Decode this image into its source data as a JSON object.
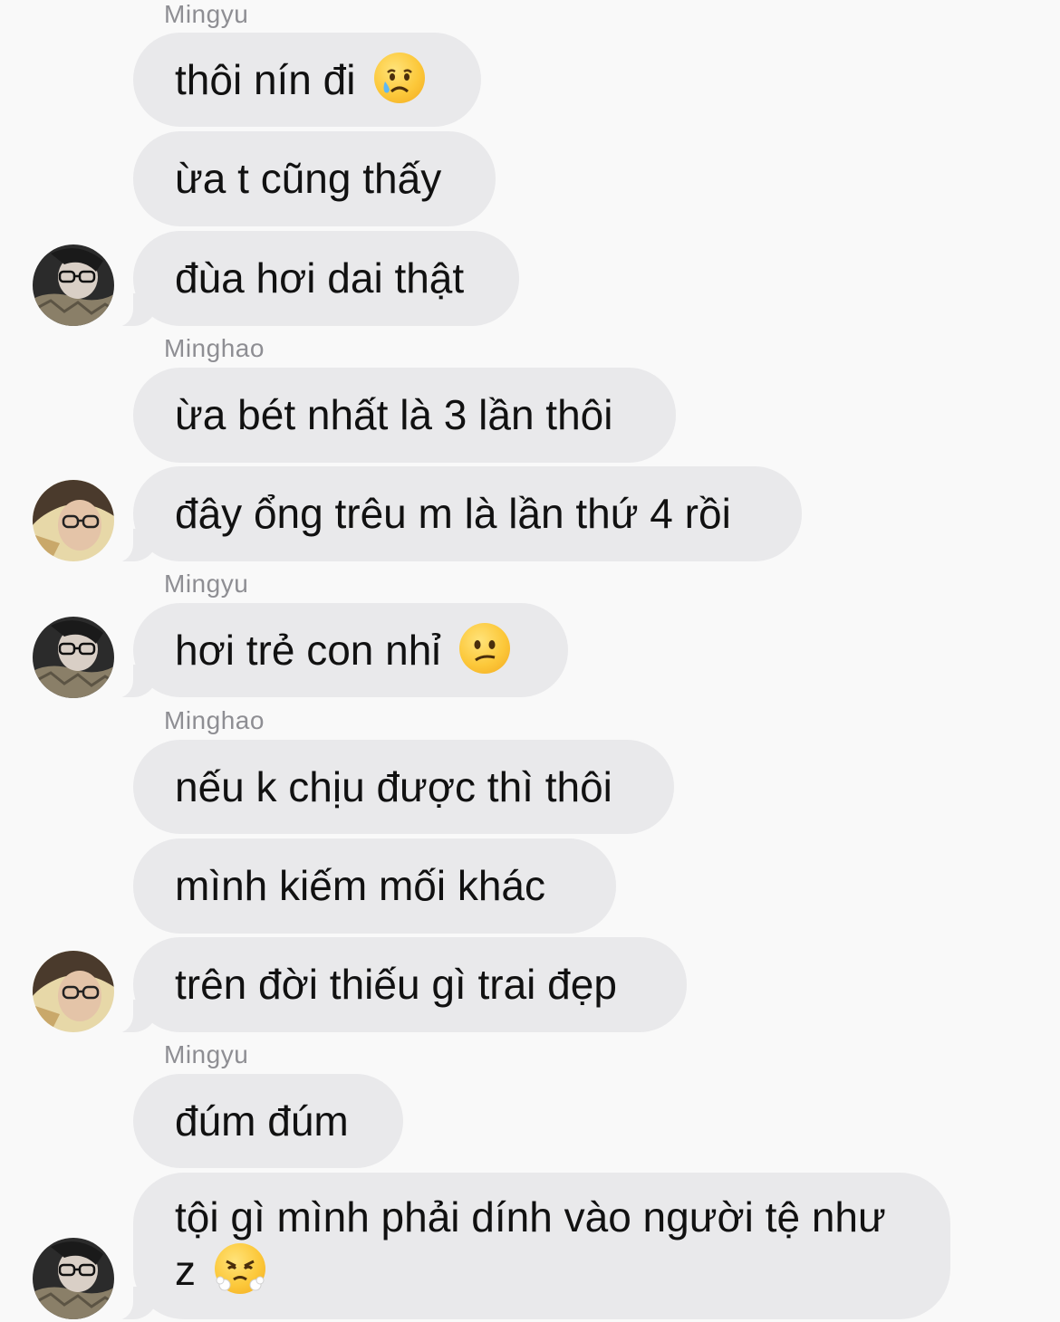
{
  "messages": [
    {
      "sender": "Mingyu",
      "text": "thôi nín đi",
      "emoji": "crying-face-icon"
    },
    {
      "text": "ừa t cũng thấy"
    },
    {
      "text": "đùa hơi dai thật",
      "avatar": "mingyu-avatar"
    },
    {
      "sender": "Minghao",
      "text": "ừa bét nhất là 3 lần thôi"
    },
    {
      "text": "đây ổng trêu m là lần thứ 4 rồi",
      "avatar": "minghao-avatar"
    },
    {
      "sender": "Mingyu",
      "text": "hơi trẻ con nhỉ",
      "emoji": "confused-face-icon",
      "avatar": "mingyu-avatar"
    },
    {
      "sender": "Minghao",
      "text": "nếu k chịu được thì thôi"
    },
    {
      "text": "mình kiếm mối khác"
    },
    {
      "text": "trên đời thiếu gì trai đẹp",
      "avatar": "minghao-avatar"
    },
    {
      "sender": "Mingyu",
      "text": "đúm đúm"
    },
    {
      "text": "tội gì mình phải dính vào người tệ như z",
      "emoji": "steam-from-nose-face-icon",
      "avatar": "mingyu-avatar"
    }
  ],
  "colors": {
    "background": "#f9f9f9",
    "bubble": "#e9e9eb",
    "sender_name": "#8e8e93",
    "text": "#111111"
  }
}
